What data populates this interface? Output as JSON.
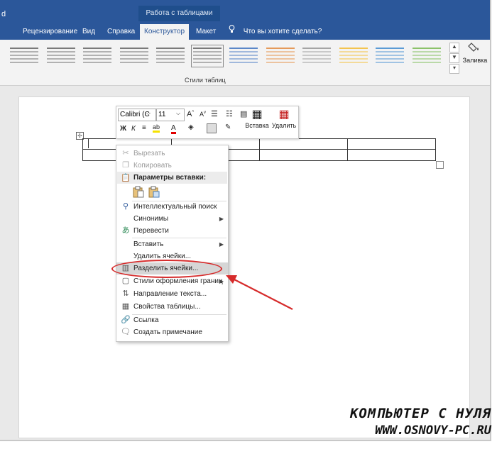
{
  "ribbon": {
    "app_letter": "d",
    "context_header": "Работа с таблицами",
    "tabs": [
      {
        "label": "Рецензирование"
      },
      {
        "label": "Вид"
      },
      {
        "label": "Справка"
      },
      {
        "label": "Конструктор"
      },
      {
        "label": "Макет"
      }
    ],
    "active_tab": "Конструктор",
    "tell_me": "Что вы хотите сделать?",
    "group_label": "Стили таблиц",
    "fill_label": "Заливка",
    "style_swatch_colors": [
      "#7a7a7a",
      "#7a7a7a",
      "#7a7a7a",
      "#7a7a7a",
      "#7a7a7a",
      "#7a7a7a",
      "#5b87c8",
      "#e59a5a",
      "#a5a5a5",
      "#f3c44f",
      "#5b9bd5",
      "#8bc26a"
    ]
  },
  "mini_toolbar": {
    "font": "Calibri (С",
    "size": "11",
    "insert_label": "Вставка",
    "delete_label": "Удалить"
  },
  "context_menu": {
    "items": [
      {
        "label": "Вырезать",
        "icon": "scissors-icon"
      },
      {
        "label": "Копировать",
        "icon": "copy-icon"
      },
      {
        "label": "Параметры вставки:",
        "icon": "paste-icon"
      },
      {
        "label": "Интеллектуальный поиск",
        "icon": "smart-lookup-icon"
      },
      {
        "label": "Синонимы"
      },
      {
        "label": "Перевести",
        "icon": "translate-icon"
      },
      {
        "label": "Вставить"
      },
      {
        "label": "Удалить ячейки..."
      },
      {
        "label": "Разделить ячейки...",
        "icon": "split-cells-icon"
      },
      {
        "label": "Стили оформления границ",
        "icon": "border-styles-icon"
      },
      {
        "label": "Направление текста...",
        "icon": "text-direction-icon"
      },
      {
        "label": "Свойства таблицы...",
        "icon": "table-properties-icon"
      },
      {
        "label": "Ссылка",
        "icon": "link-icon"
      },
      {
        "label": "Создать примечание",
        "icon": "comment-icon"
      }
    ]
  },
  "watermark": {
    "line1": "КОМПЬЮТЕР С НУЛЯ",
    "line2": "WWW.OSNOVY-PC.RU"
  },
  "colors": {
    "ribbon_blue": "#2b579a",
    "highlight_ellipse": "#d62b2b",
    "annotation_arrow": "#d62b2b"
  }
}
